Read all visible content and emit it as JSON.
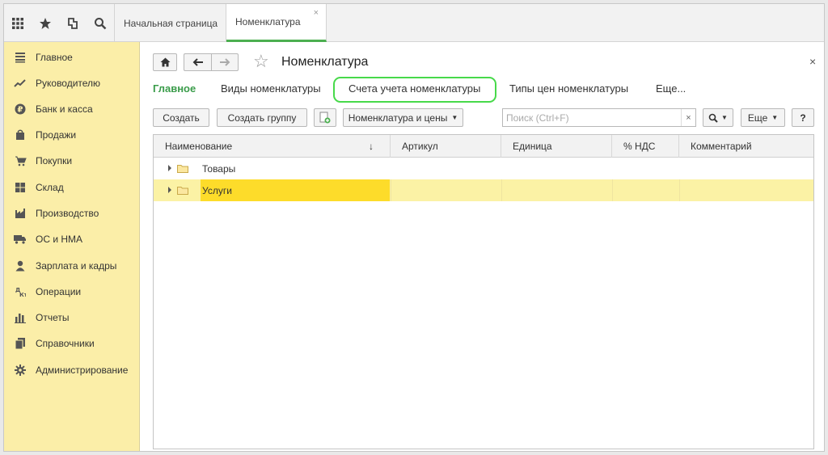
{
  "tabs": {
    "home": "Начальная страница",
    "active": "Номенклатура",
    "close": "×"
  },
  "toolbar_icons": [
    "apps-grid-icon",
    "star-icon",
    "history-icon",
    "search-icon"
  ],
  "sidebar": {
    "items": [
      {
        "label": "Главное",
        "icon": "menu-lines-icon"
      },
      {
        "label": "Руководителю",
        "icon": "trend-icon"
      },
      {
        "label": "Банк и касса",
        "icon": "ruble-icon"
      },
      {
        "label": "Продажи",
        "icon": "bag-icon"
      },
      {
        "label": "Покупки",
        "icon": "cart-icon"
      },
      {
        "label": "Склад",
        "icon": "warehouse-icon"
      },
      {
        "label": "Производство",
        "icon": "factory-icon"
      },
      {
        "label": "ОС и НМА",
        "icon": "truck-icon"
      },
      {
        "label": "Зарплата и кадры",
        "icon": "person-icon"
      },
      {
        "label": "Операции",
        "icon": "operations-icon"
      },
      {
        "label": "Отчеты",
        "icon": "bar-chart-icon"
      },
      {
        "label": "Справочники",
        "icon": "book-icon"
      },
      {
        "label": "Администрирование",
        "icon": "gear-icon"
      }
    ]
  },
  "header": {
    "title": "Номенклатура",
    "close": "×"
  },
  "subnav": {
    "main": "Главное",
    "kinds": "Виды номенклатуры",
    "accounts": "Счета учета номенклатуры",
    "price_types": "Типы цен номенклатуры",
    "more": "Еще..."
  },
  "buttons": {
    "create": "Создать",
    "create_group": "Создать группу",
    "nomenclature_prices": "Номенклатура и цены",
    "more": "Еще",
    "help": "?"
  },
  "search": {
    "placeholder": "Поиск (Ctrl+F)",
    "clear": "×"
  },
  "table": {
    "columns": [
      "Наименование",
      "Артикул",
      "Единица",
      "% НДС",
      "Комментарий"
    ],
    "sort_indicator": "↓",
    "rows": [
      {
        "name": "Товары",
        "selected": false
      },
      {
        "name": "Услуги",
        "selected": true
      }
    ]
  },
  "colors": {
    "sidebar_bg": "#fbeea8",
    "accent_green": "#4caf50",
    "selected_row": "#fbf2a5",
    "selected_cell": "#fddc2a",
    "highlight_outline": "#47d94a"
  }
}
